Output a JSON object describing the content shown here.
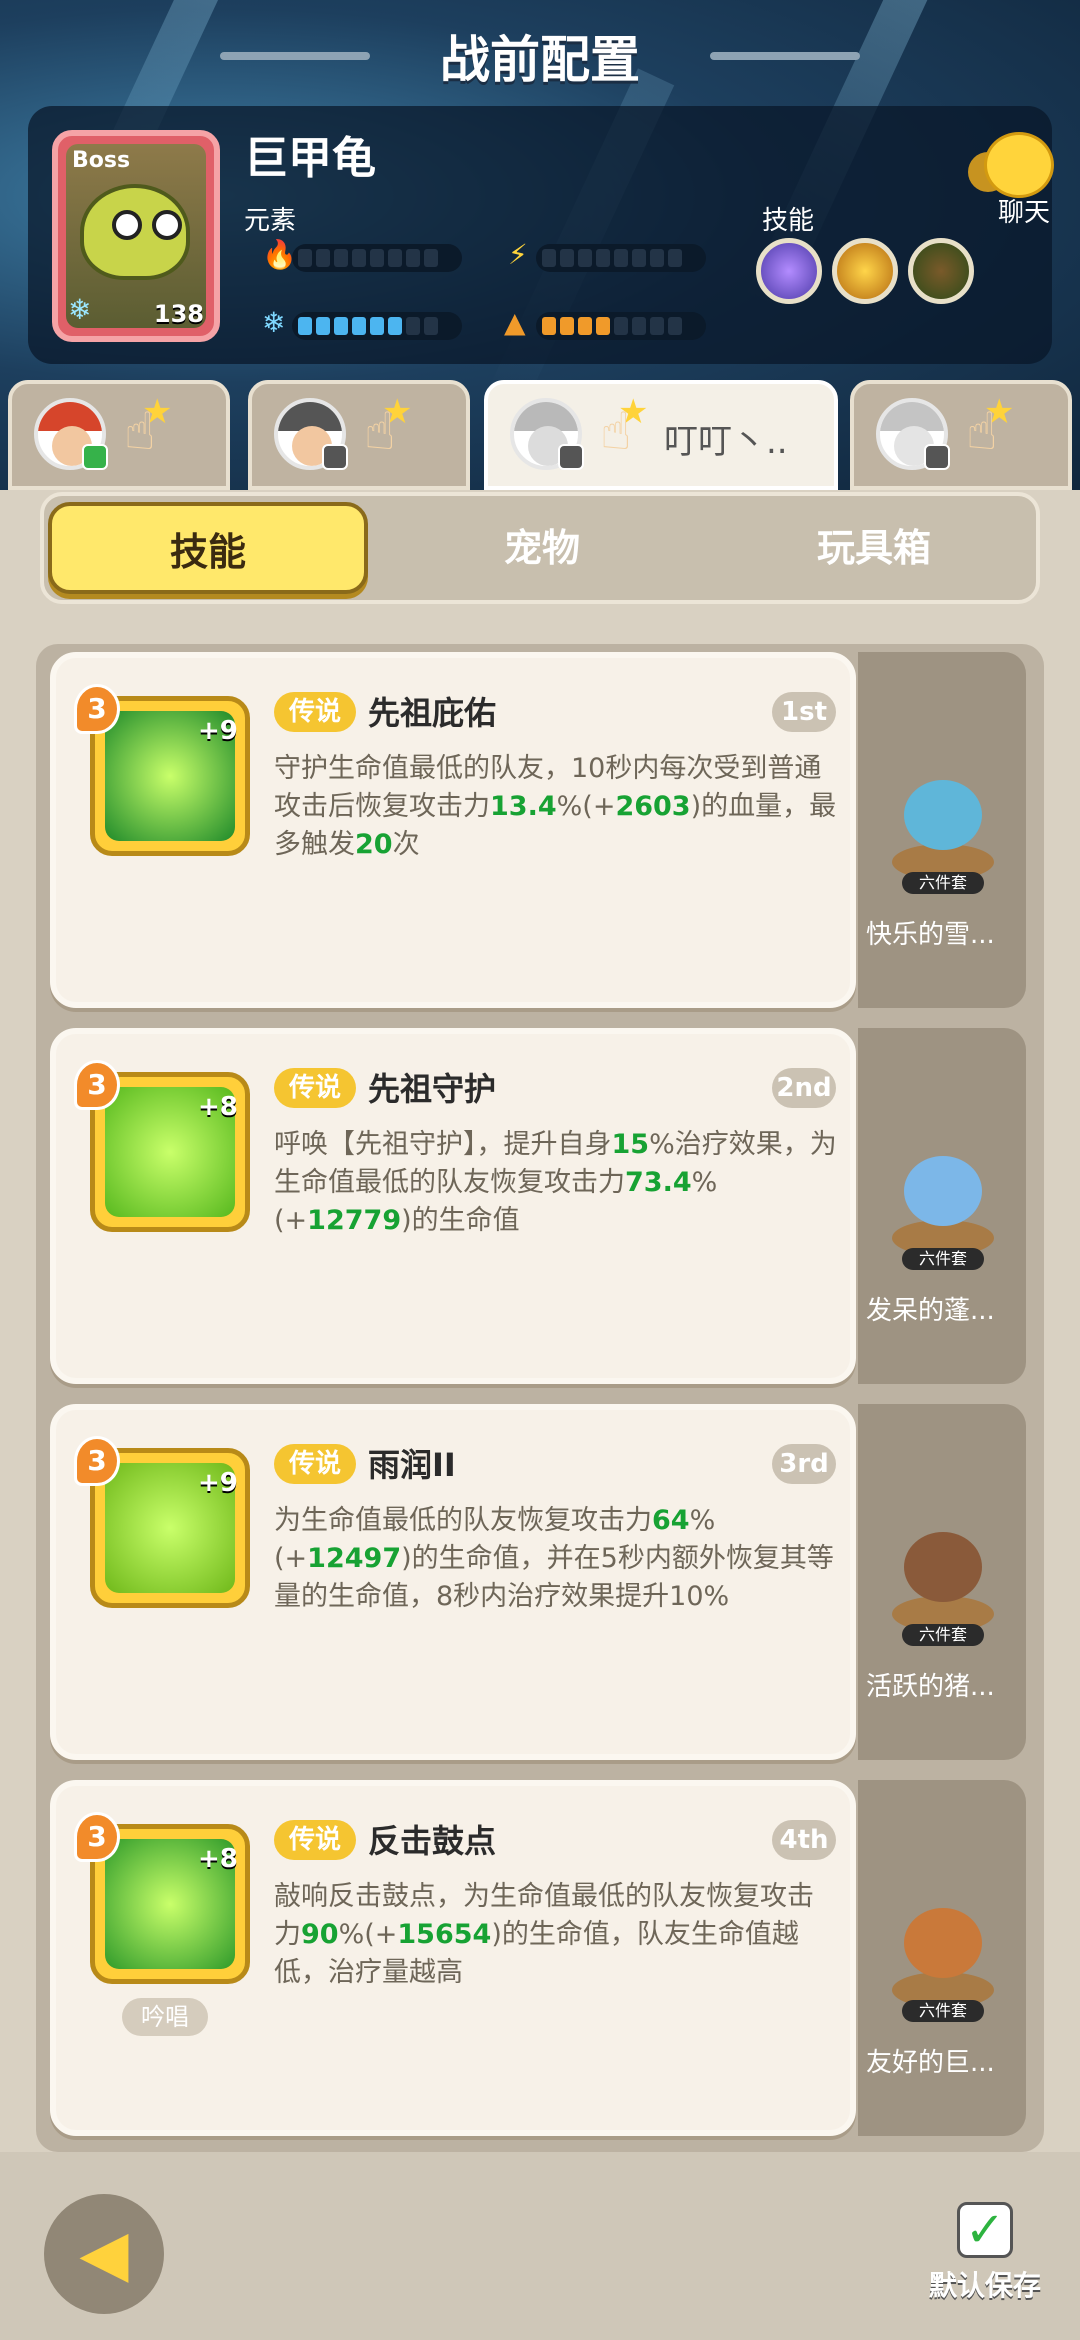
{
  "header": {
    "title": "战前配置"
  },
  "boss": {
    "tag": "Boss",
    "name": "巨甲龟",
    "level": "138",
    "element_label": "元素",
    "skill_label": "技能",
    "element_levels": {
      "fire": 0,
      "lightning": 0,
      "ice": 6,
      "earth": 4
    },
    "skills": [
      {
        "icon": "purple-swirl-icon"
      },
      {
        "icon": "golden-crown-icon"
      },
      {
        "icon": "dark-cloak-icon"
      }
    ]
  },
  "chat": {
    "label": "聊天"
  },
  "heroes": [
    {
      "nickname": "",
      "hair_color": "#d6452b",
      "badge_color": "#36b24a",
      "active": false
    },
    {
      "nickname": "",
      "hair_color": "#555555",
      "badge_color": "#555555",
      "active": false
    },
    {
      "nickname": "叮叮丶..",
      "hair_color": "#b9b9b9",
      "badge_color": "#555555",
      "active": true
    },
    {
      "nickname": "",
      "hair_color": "#c4c4c4",
      "badge_color": "#555555",
      "active": false
    }
  ],
  "subtabs": {
    "skills": "技能",
    "pets": "宠物",
    "toybox": "玩具箱"
  },
  "cards": [
    {
      "level": "3",
      "plus": "+9",
      "rarity": "传说",
      "name": "先祖庇佑",
      "rank": "1st",
      "icon_color": "#1f8a2a",
      "icon_glyph": "shield-icon",
      "desc_parts": [
        "守护生命值最低的队友，10秒内每次受到普通攻击后恢复攻击力",
        "13.4",
        "%(+",
        "2603",
        ")的血量，最多触发",
        "20",
        "次"
      ],
      "chant": "",
      "pet": {
        "name": "快乐的雪...",
        "set_label": "六件套",
        "color": "#5fb6d9"
      }
    },
    {
      "level": "3",
      "plus": "+8",
      "rarity": "传说",
      "name": "先祖守护",
      "rank": "2nd",
      "icon_color": "#57b81e",
      "icon_glyph": "hourglass-icon",
      "desc_parts": [
        "呼唤【先祖守护】，提升自身",
        "15",
        "%治疗效果，为生命值最低的队友恢复攻击力",
        "73.4",
        "%(+",
        "12779",
        ")的生命值"
      ],
      "chant": "",
      "pet": {
        "name": "发呆的蓬...",
        "set_label": "六件套",
        "color": "#7cb7e8"
      }
    },
    {
      "level": "3",
      "plus": "+9",
      "rarity": "传说",
      "name": "雨润II",
      "rank": "3rd",
      "icon_color": "#6fb81a",
      "icon_glyph": "heal-cross-icon",
      "desc_parts": [
        "为生命值最低的队友恢复攻击力",
        "64",
        "%(+",
        "12497",
        ")的生命值，并在5秒内额外恢复其等量的生命值，8秒内治疗效果提升10%"
      ],
      "chant": "",
      "pet": {
        "name": "活跃的猪...",
        "set_label": "六件套",
        "color": "#8a5a3a"
      }
    },
    {
      "level": "3",
      "plus": "+8",
      "rarity": "传说",
      "name": "反击鼓点",
      "rank": "4th",
      "icon_color": "#2f9a2a",
      "icon_glyph": "drum-cross-icon",
      "desc_parts": [
        "敲响反击鼓点，为生命值最低的队友恢复攻击力",
        "90",
        "%(+",
        "15654",
        ")的生命值，队友生命值越低，治疗量越高"
      ],
      "chant": "吟唱",
      "pet": {
        "name": "友好的巨...",
        "set_label": "六件套",
        "color": "#c9793a"
      }
    }
  ],
  "footer": {
    "save_label": "默认保存"
  },
  "colors": {
    "accent_yellow": "#ffe86b",
    "legend_gold": "#f5c531",
    "green_number": "#17a233"
  }
}
